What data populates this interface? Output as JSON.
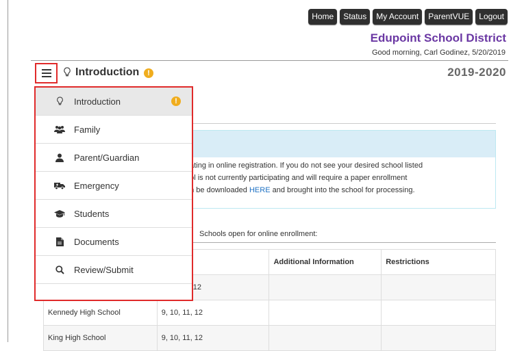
{
  "topnav": [
    "Home",
    "Status",
    "My Account",
    "ParentVUE",
    "Logout"
  ],
  "district": "Edupoint School District",
  "greeting": "Good morning, Carl Godinez, 5/20/2019",
  "header": {
    "title": "Introduction",
    "year": "2019-2020",
    "warn": "!"
  },
  "menu": [
    {
      "label": "Introduction",
      "icon": "lightbulb-icon",
      "active": true,
      "warn": "!"
    },
    {
      "label": "Family",
      "icon": "users-icon"
    },
    {
      "label": "Parent/Guardian",
      "icon": "user-icon"
    },
    {
      "label": "Emergency",
      "icon": "ambulance-icon"
    },
    {
      "label": "Students",
      "icon": "graduation-cap-icon"
    },
    {
      "label": "Documents",
      "icon": "document-icon"
    },
    {
      "label": "Review/Submit",
      "icon": "search-icon"
    }
  ],
  "info": {
    "line1": "pating in online registration. If you do not see your desired school listed",
    "line2": "ool is not currently participating and will require a paper enrollment",
    "line3_pre": "an be downloaded ",
    "line3_link": "HERE",
    "line3_post": " and brought into the school for processing."
  },
  "schools_label": "Schools open for online enrollment:",
  "table": {
    "headers": [
      "",
      "",
      "Additional Information",
      "Restrictions"
    ],
    "rows": [
      [
        "",
        "12",
        "",
        ""
      ],
      [
        "Kennedy High School",
        "9, 10, 11, 12",
        "",
        ""
      ],
      [
        "King High School",
        "9, 10, 11, 12",
        "",
        ""
      ]
    ]
  },
  "colors": {
    "accent": "#6a37a3",
    "highlight": "#e02a2a",
    "warn": "#f0ad1e",
    "link": "#1f72c4"
  }
}
